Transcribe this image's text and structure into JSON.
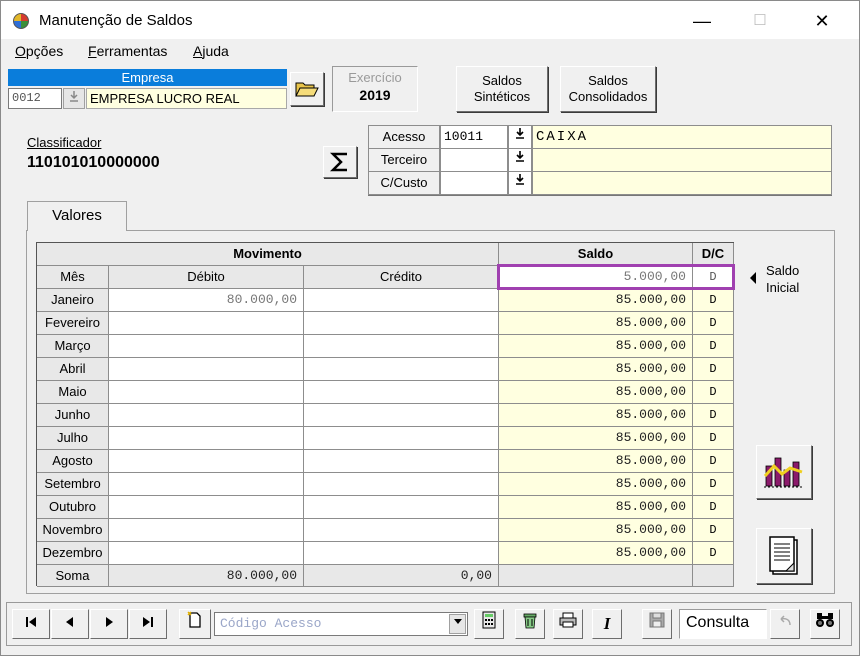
{
  "window": {
    "title": "Manutenção de Saldos",
    "minimize_glyph": "—",
    "maximize_glyph": "☐",
    "close_glyph": "✕"
  },
  "menu": {
    "opcoes": {
      "first": "O",
      "rest": "pções"
    },
    "ferramentas": {
      "first": "F",
      "rest": "erramentas"
    },
    "ajuda": {
      "first": "A",
      "rest": "juda"
    }
  },
  "empresa": {
    "label": "Empresa",
    "code": "0012",
    "name": "EMPRESA LUCRO REAL"
  },
  "exercicio": {
    "label": "Exercício",
    "year": "2019"
  },
  "buttons": {
    "saldos_sinteticos_1": "Saldos",
    "saldos_sinteticos_2": "Sintéticos",
    "saldos_consolidados_1": "Saldos",
    "saldos_consolidados_2": "Consolidados"
  },
  "classificador": {
    "label": "Classificador",
    "value": "110101010000000"
  },
  "acesso": {
    "rows": [
      {
        "label": "Acesso",
        "code": "10011",
        "desc": "CAIXA"
      },
      {
        "label": "Terceiro",
        "code": "",
        "desc": ""
      },
      {
        "label": "C/Custo",
        "code": "",
        "desc": ""
      }
    ]
  },
  "tab": {
    "label": "Valores"
  },
  "grid": {
    "header_movimento": "Movimento",
    "header_saldo": "Saldo",
    "header_dc": "D/C",
    "col_mes": "Mês",
    "col_debito": "Débito",
    "col_credito": "Crédito",
    "saldo_inicial": {
      "value": "5.000,00",
      "dc": "D"
    },
    "rows": [
      {
        "month": "Janeiro",
        "debito": "80.000,00",
        "credito": "",
        "saldo": "85.000,00",
        "dc": "D"
      },
      {
        "month": "Fevereiro",
        "debito": "",
        "credito": "",
        "saldo": "85.000,00",
        "dc": "D"
      },
      {
        "month": "Março",
        "debito": "",
        "credito": "",
        "saldo": "85.000,00",
        "dc": "D"
      },
      {
        "month": "Abril",
        "debito": "",
        "credito": "",
        "saldo": "85.000,00",
        "dc": "D"
      },
      {
        "month": "Maio",
        "debito": "",
        "credito": "",
        "saldo": "85.000,00",
        "dc": "D"
      },
      {
        "month": "Junho",
        "debito": "",
        "credito": "",
        "saldo": "85.000,00",
        "dc": "D"
      },
      {
        "month": "Julho",
        "debito": "",
        "credito": "",
        "saldo": "85.000,00",
        "dc": "D"
      },
      {
        "month": "Agosto",
        "debito": "",
        "credito": "",
        "saldo": "85.000,00",
        "dc": "D"
      },
      {
        "month": "Setembro",
        "debito": "",
        "credito": "",
        "saldo": "85.000,00",
        "dc": "D"
      },
      {
        "month": "Outubro",
        "debito": "",
        "credito": "",
        "saldo": "85.000,00",
        "dc": "D"
      },
      {
        "month": "Novembro",
        "debito": "",
        "credito": "",
        "saldo": "85.000,00",
        "dc": "D"
      },
      {
        "month": "Dezembro",
        "debito": "",
        "credito": "",
        "saldo": "85.000,00",
        "dc": "D"
      }
    ],
    "soma": {
      "label": "Soma",
      "debito": "80.000,00",
      "credito": "0,00"
    }
  },
  "side": {
    "saldo_inicial_1": "Saldo",
    "saldo_inicial_2": "Inicial"
  },
  "toolbar": {
    "codigo_placeholder": "Código Acesso",
    "mode": "Consulta"
  },
  "colors": {
    "accent_blue": "#0a7ddb",
    "highlight_purple": "#a040b0",
    "field_yellow": "#ffffe0"
  },
  "icons": [
    "folder-open-icon",
    "sigma-icon",
    "chart-icon",
    "report-icon",
    "first-icon",
    "prev-icon",
    "next-icon",
    "last-icon",
    "new-doc-icon",
    "calculator-icon",
    "trash-icon",
    "printer-icon",
    "italic-icon",
    "save-icon",
    "undo-icon",
    "binoculars-icon"
  ]
}
